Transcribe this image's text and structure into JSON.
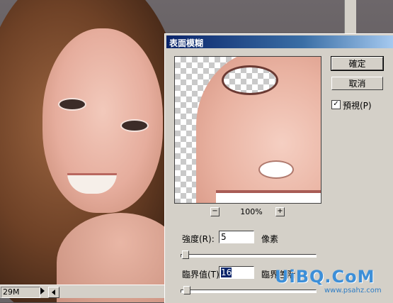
{
  "status_bar": {
    "value": "29M"
  },
  "dialog": {
    "title": "表面模糊",
    "buttons": {
      "ok": "確定",
      "cancel": "取消"
    },
    "preview_checkbox": {
      "label": "預視(P)",
      "checked": true,
      "check_mark": "✓"
    },
    "zoom": {
      "level": "100%",
      "minus": "−",
      "plus": "+"
    },
    "radius": {
      "label": "強度(R):",
      "value": "5",
      "unit": "像素",
      "slider_fraction": 0.03
    },
    "threshold": {
      "label": "臨界值(T):",
      "value": "16",
      "unit": "臨界色階",
      "slider_fraction": 0.05
    }
  },
  "watermark": {
    "text": "UiBQ.CoM",
    "sub": "www.psahz.com"
  },
  "colors": {
    "titlebar": "#0a246a",
    "dialog_bg": "#d4d0c8",
    "watermark": "#3d8fd8"
  }
}
